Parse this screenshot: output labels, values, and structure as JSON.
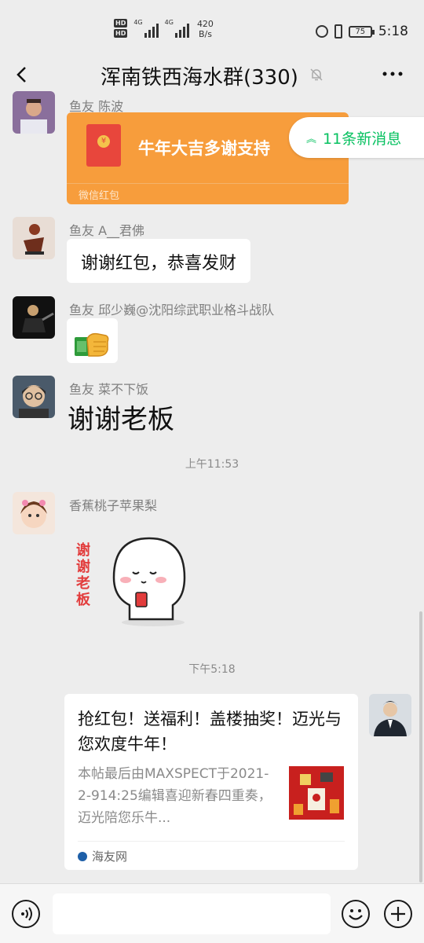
{
  "status_bar": {
    "hd1": "HD",
    "hd2": "HD",
    "net1": "4G",
    "net2": "4G",
    "speed_value": "420",
    "speed_unit": "B/s",
    "battery": "75",
    "time": "5:18"
  },
  "header": {
    "back_icon": "chevron-left-icon",
    "title": "浑南铁西海水群(330)",
    "mute_icon": "bell-off-icon",
    "more_icon": "more-dots-icon"
  },
  "messages": [
    {
      "type": "red_packet",
      "sender": "鱼友 陈波",
      "text": "牛年大吉多谢支持",
      "footer": "微信红包",
      "color": "#f79d3c"
    },
    {
      "type": "text",
      "sender": "鱼友 A__君佛",
      "text": "谢谢红包，恭喜发财"
    },
    {
      "type": "emoji",
      "sender": "鱼友 邱少巍@沈阳综武职业格斗战队",
      "emoji_icon": "money-hand-icon"
    },
    {
      "type": "big_text",
      "sender": "鱼友 菜不下饭",
      "text": "谢谢老板"
    },
    {
      "type": "time",
      "text": "上午11:53"
    },
    {
      "type": "sticker",
      "sender": "香蕉桃子苹果梨",
      "sticker_text": [
        "谢",
        "谢",
        "老",
        "板"
      ]
    },
    {
      "type": "time",
      "text": "下午5:18"
    },
    {
      "type": "link",
      "title": "抢红包！送福利！盖楼抽奖！迈光与您欢度牛年！",
      "desc": "本帖最后由MAXSPECT于2021-2-914:25编辑喜迎新春四重奏，迈光陪您乐牛...",
      "source": "海友网"
    }
  ],
  "new_messages_badge": "11条新消息",
  "input_bar": {
    "voice_icon": "voice-icon",
    "emoji_icon": "emoji-face-icon",
    "plus_icon": "plus-icon"
  },
  "colors": {
    "background": "#ededed",
    "accent": "#07c160",
    "red_packet": "#f79d3c"
  }
}
